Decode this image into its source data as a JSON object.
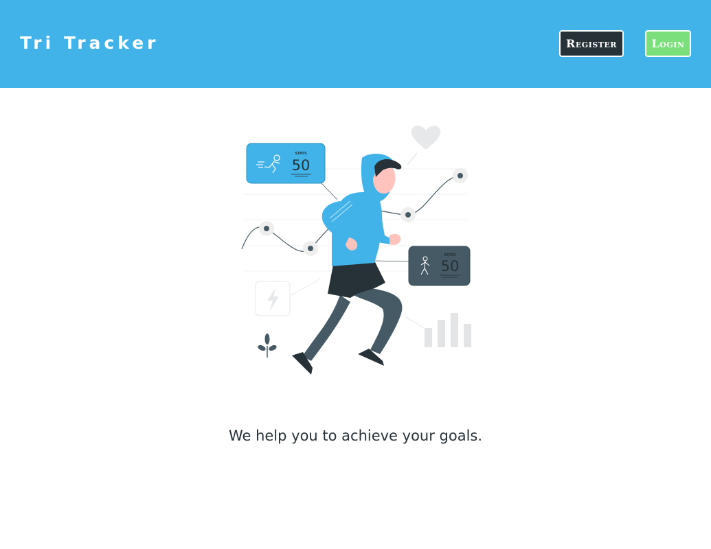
{
  "header": {
    "brand": "Tri Tracker",
    "register_label": "Register",
    "login_label": "Login"
  },
  "hero": {
    "card_top": {
      "label": "STATS",
      "value": "50"
    },
    "card_bottom": {
      "label": "STATS",
      "value": "50"
    },
    "icons": [
      "heart-icon",
      "lightning-icon",
      "plant-icon",
      "bar-chart-icon",
      "running-person-icon"
    ]
  },
  "tagline": "We help you to achieve your goals.",
  "colors": {
    "header_bg": "#42b3e8",
    "register_bg": "#263238",
    "login_bg": "#7be07b",
    "card_blue": "#42b3e8",
    "card_dark": "#455a64",
    "text_dark": "#263238"
  }
}
